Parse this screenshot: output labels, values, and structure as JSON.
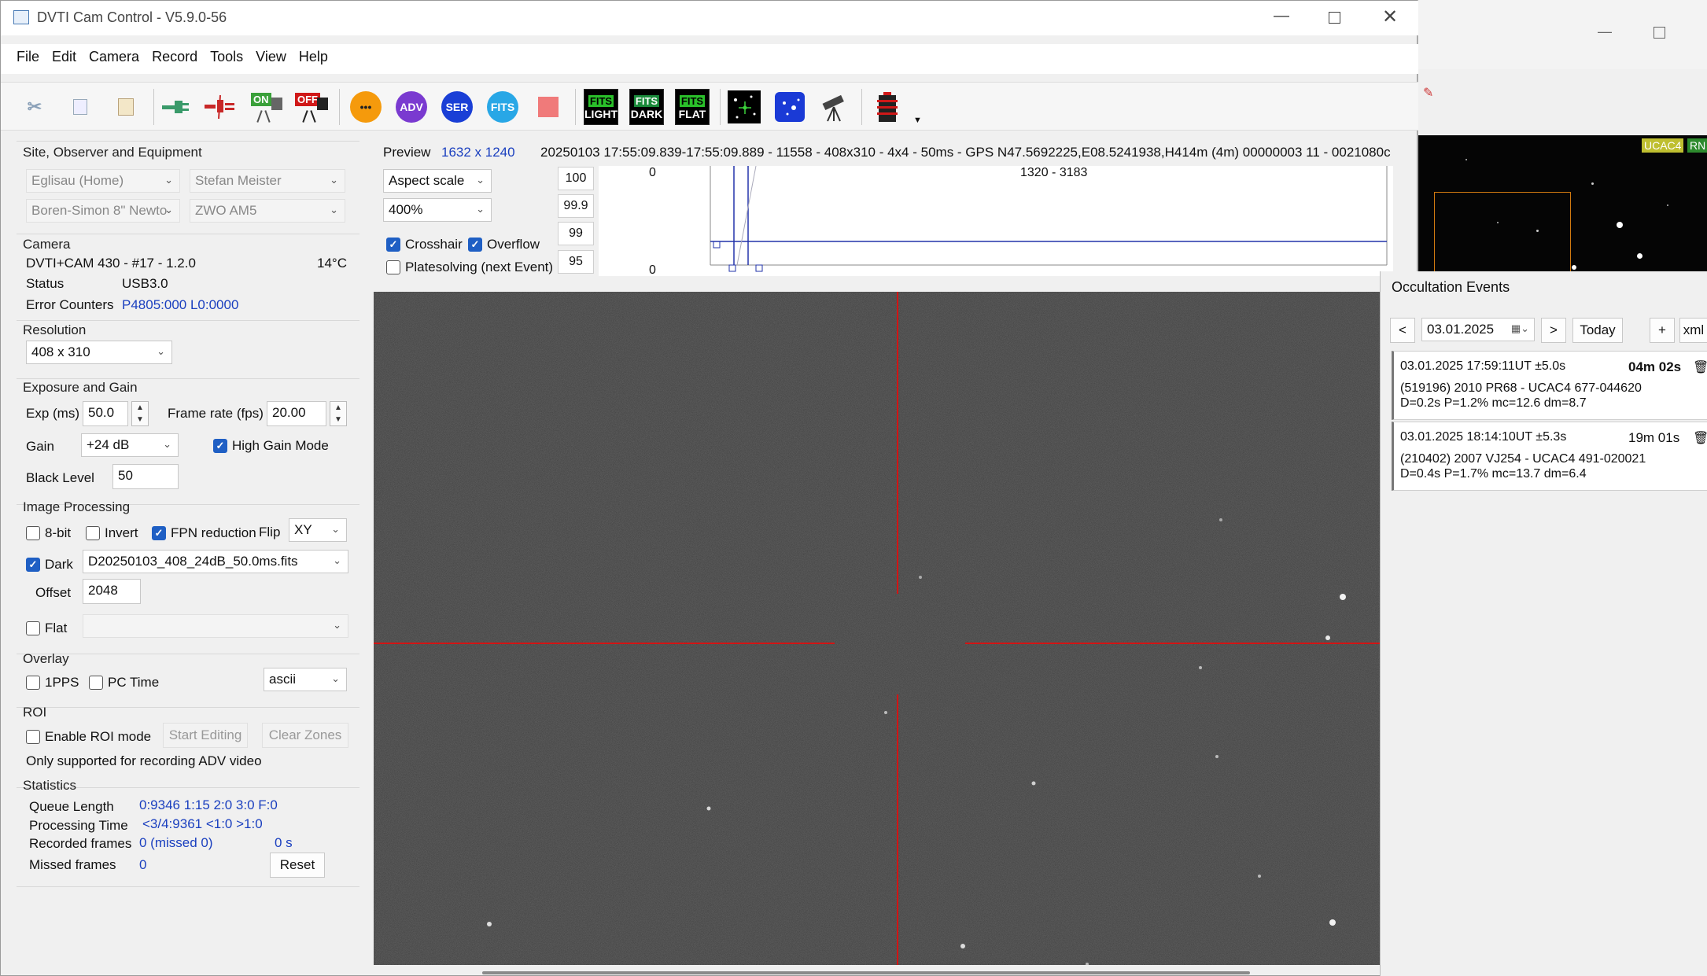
{
  "window": {
    "title": "DVTI Cam Control - V5.9.0-56"
  },
  "menu": [
    "File",
    "Edit",
    "Camera",
    "Record",
    "Tools",
    "View",
    "Help"
  ],
  "toolbar": {
    "on_label": "ON",
    "off_label": "OFF",
    "adv_label": "ADV",
    "ser_label": "SER",
    "fits_label": "FITS",
    "dots_label": "•••",
    "fits_light": "LIGHT",
    "fits_dark": "DARK",
    "fits_flat": "FLAT",
    "fits_top": "FITS"
  },
  "site": {
    "title": "Site, Observer and Equipment",
    "site": "Eglisau (Home)",
    "observer": "Stefan Meister",
    "telescope": "Boren-Simon 8\" Newto",
    "camera_model": "ZWO AM5"
  },
  "camera": {
    "title": "Camera",
    "name": "DVTI+CAM 430  -  #17  -  1.2.0",
    "temp": "14°C",
    "status_label": "Status",
    "status_value": "USB3.0",
    "errors_label": "Error Counters",
    "errors_value": "P4805:000 L0:0000"
  },
  "resolution": {
    "title": "Resolution",
    "value": "408 x 310"
  },
  "exposure": {
    "title": "Exposure and Gain",
    "exp_label": "Exp (ms)",
    "exp_value": "50.0",
    "fps_label": "Frame rate (fps)",
    "fps_value": "20.00",
    "gain_label": "Gain",
    "gain_value": "+24 dB",
    "high_gain_label": "High Gain Mode",
    "black_label": "Black Level",
    "black_value": "50"
  },
  "processing": {
    "title": "Image Processing",
    "bit8_label": "8-bit",
    "invert_label": "Invert",
    "fpn_label": "FPN reduction",
    "flip_label": "Flip",
    "flip_value": "XY",
    "dark_label": "Dark",
    "dark_file": "D20250103_408_24dB_50.0ms.fits",
    "offset_label": "Offset",
    "offset_value": "2048",
    "flat_label": "Flat"
  },
  "overlay": {
    "title": "Overlay",
    "pps_label": "1PPS",
    "pctime_label": "PC Time",
    "format_value": "ascii"
  },
  "roi": {
    "title": "ROI",
    "enable_label": "Enable ROI mode",
    "start_label": "Start Editing",
    "clear_label": "Clear Zones",
    "note": "Only supported for recording ADV video"
  },
  "stats": {
    "title": "Statistics",
    "queue_label": "Queue Length",
    "queue_value": "0:9346  1:15  2:0  3:0  F:0",
    "proc_label": "Processing Time",
    "proc_value": "<3/4:9361 <1:0  >1:0",
    "recorded_label": "Recorded frames",
    "recorded_value": "0 (missed 0)",
    "recorded_time": "0 s",
    "missed_label": "Missed frames",
    "missed_value": "0",
    "reset_label": "Reset"
  },
  "preview": {
    "label": "Preview",
    "size": "1632 x 1240",
    "info": "20250103 17:55:09.839-17:55:09.889 - 11558 - 408x310 - 4x4 - 50ms - GPS N47.5692225,E08.5241938,H414m (4m) 00000003 11 - 0021080c",
    "scale_mode": "Aspect scale",
    "zoom": "400%",
    "crosshair_label": "Crosshair",
    "overflow_label": "Overflow",
    "platesolving_label": "Platesolving (next Event)",
    "levels": [
      "100",
      "99.9",
      "99",
      "95"
    ],
    "hist_top": "0",
    "hist_bottom": "0",
    "hist_range": "1320 - 3183"
  },
  "events": {
    "title": "Occultation Events",
    "prev": "<",
    "next": ">",
    "date": "03.01.2025",
    "today": "Today",
    "add": "+",
    "xml": "xml",
    "items": [
      {
        "time": "03.01.2025 17:59:11UT ±5.0s",
        "countdown": "04m 02s",
        "target": "(519196) 2010 PR68 - UCAC4 677-044620",
        "details": "D=0.2s   P=1.2%   mc=12.6   dm=8.7"
      },
      {
        "time": "03.01.2025 18:14:10UT ±5.3s",
        "countdown": "19m 01s",
        "target": "(210402) 2007 VJ254 - UCAC4 491-020021",
        "details": "D=0.4s   P=1.7%   mc=13.7   dm=6.4"
      }
    ]
  },
  "bgwin": {
    "badge1": "UCAC4",
    "badge2": "RN"
  },
  "colors": {
    "accent": "#1f5fc4",
    "crosshair": "#d21414",
    "link": "#1a3fbf"
  }
}
